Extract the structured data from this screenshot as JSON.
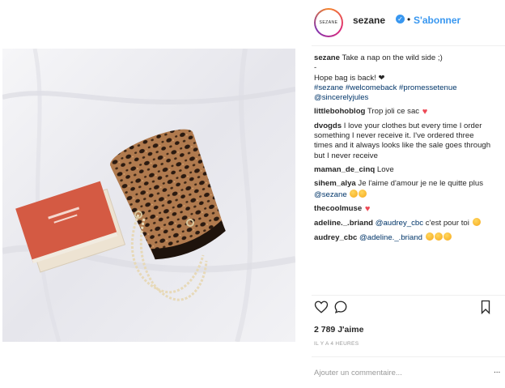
{
  "post": {
    "account": {
      "username": "sezane",
      "avatar_text": "SEZANE",
      "follow_label": "S'abonner",
      "separator": "•"
    },
    "caption": {
      "username": "sezane",
      "text": "Take a nap on the wild side ;)",
      "line2": "-",
      "line3": "Hope bag is back! ❤",
      "hashtags": "#sezane #welcomeback #promessetenue",
      "mention": "@sincerelyjules"
    },
    "comments": [
      {
        "user": "littlebohoblog",
        "text": "Trop joli ce sac"
      },
      {
        "user": "dvogds",
        "text": "I love your clothes but every time I order something I never receive it. I've ordered three times and it always looks like the sale goes through but I never receive"
      },
      {
        "user": "maman_de_cinq",
        "text": "Love"
      },
      {
        "user": "sihem_alya",
        "text": "Je l'aime d'amour je ne le quitte plus",
        "mention": "@sezane"
      },
      {
        "user": "thecoolmuse",
        "text": ""
      },
      {
        "user": "adeline._.briand",
        "mention": "@audrey_cbc",
        "text": "c'est pour toi"
      },
      {
        "user": "audrey_cbc",
        "mention": "@adeline._.briand",
        "text": ""
      }
    ],
    "likes": "2 789 J'aime",
    "time": "IL Y A 4 HEURES",
    "add_comment_placeholder": "Ajouter un commentaire...",
    "more_label": "..."
  },
  "icons": {
    "like": "heart-outline-icon",
    "comment": "comment-bubble-icon",
    "save": "bookmark-icon",
    "verified": "verified-badge-icon"
  },
  "colors": {
    "link": "#3897f0",
    "hashtag": "#003569",
    "heart": "#ed4956"
  }
}
